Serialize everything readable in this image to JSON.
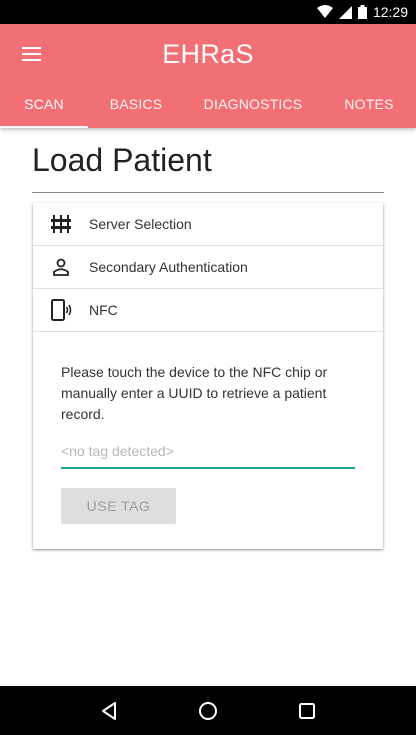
{
  "status_bar": {
    "time": "12:29",
    "icons": [
      "wifi-icon",
      "cell-signal-icon",
      "battery-icon"
    ]
  },
  "app_bar": {
    "title": "EHRaS",
    "menu_icon": "hamburger-menu-icon",
    "color": "#f26f75"
  },
  "tabs": [
    {
      "label": "SCAN",
      "active": true
    },
    {
      "label": "BASICS",
      "active": false
    },
    {
      "label": "DIAGNOSTICS",
      "active": false
    },
    {
      "label": "NOTES",
      "active": false
    }
  ],
  "page": {
    "title": "Load Patient"
  },
  "steps": [
    {
      "label": "Server Selection",
      "icon": "server-icon"
    },
    {
      "label": "Secondary Authentication",
      "icon": "person-icon"
    },
    {
      "label": "NFC",
      "icon": "nfc-phone-icon"
    }
  ],
  "nfc": {
    "message": "Please touch the device to the NFC chip or manually enter a UUID to retrieve a patient record.",
    "input_value": "",
    "input_placeholder": "<no tag detected>",
    "button_label": "USE TAG"
  },
  "nav_bar": {
    "icons": [
      "back-icon",
      "home-icon",
      "recents-icon"
    ]
  },
  "colors": {
    "accent": "#1aa79a",
    "app_bar": "#f26f75"
  }
}
